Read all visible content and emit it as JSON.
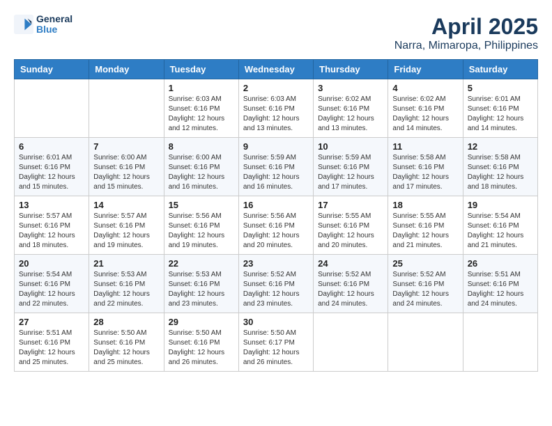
{
  "header": {
    "logo_line1": "General",
    "logo_line2": "Blue",
    "title": "April 2025",
    "subtitle": "Narra, Mimaropa, Philippines"
  },
  "weekdays": [
    "Sunday",
    "Monday",
    "Tuesday",
    "Wednesday",
    "Thursday",
    "Friday",
    "Saturday"
  ],
  "weeks": [
    [
      {
        "day": null,
        "info": null
      },
      {
        "day": null,
        "info": null
      },
      {
        "day": "1",
        "info": "Sunrise: 6:03 AM\nSunset: 6:16 PM\nDaylight: 12 hours\nand 12 minutes."
      },
      {
        "day": "2",
        "info": "Sunrise: 6:03 AM\nSunset: 6:16 PM\nDaylight: 12 hours\nand 13 minutes."
      },
      {
        "day": "3",
        "info": "Sunrise: 6:02 AM\nSunset: 6:16 PM\nDaylight: 12 hours\nand 13 minutes."
      },
      {
        "day": "4",
        "info": "Sunrise: 6:02 AM\nSunset: 6:16 PM\nDaylight: 12 hours\nand 14 minutes."
      },
      {
        "day": "5",
        "info": "Sunrise: 6:01 AM\nSunset: 6:16 PM\nDaylight: 12 hours\nand 14 minutes."
      }
    ],
    [
      {
        "day": "6",
        "info": "Sunrise: 6:01 AM\nSunset: 6:16 PM\nDaylight: 12 hours\nand 15 minutes."
      },
      {
        "day": "7",
        "info": "Sunrise: 6:00 AM\nSunset: 6:16 PM\nDaylight: 12 hours\nand 15 minutes."
      },
      {
        "day": "8",
        "info": "Sunrise: 6:00 AM\nSunset: 6:16 PM\nDaylight: 12 hours\nand 16 minutes."
      },
      {
        "day": "9",
        "info": "Sunrise: 5:59 AM\nSunset: 6:16 PM\nDaylight: 12 hours\nand 16 minutes."
      },
      {
        "day": "10",
        "info": "Sunrise: 5:59 AM\nSunset: 6:16 PM\nDaylight: 12 hours\nand 17 minutes."
      },
      {
        "day": "11",
        "info": "Sunrise: 5:58 AM\nSunset: 6:16 PM\nDaylight: 12 hours\nand 17 minutes."
      },
      {
        "day": "12",
        "info": "Sunrise: 5:58 AM\nSunset: 6:16 PM\nDaylight: 12 hours\nand 18 minutes."
      }
    ],
    [
      {
        "day": "13",
        "info": "Sunrise: 5:57 AM\nSunset: 6:16 PM\nDaylight: 12 hours\nand 18 minutes."
      },
      {
        "day": "14",
        "info": "Sunrise: 5:57 AM\nSunset: 6:16 PM\nDaylight: 12 hours\nand 19 minutes."
      },
      {
        "day": "15",
        "info": "Sunrise: 5:56 AM\nSunset: 6:16 PM\nDaylight: 12 hours\nand 19 minutes."
      },
      {
        "day": "16",
        "info": "Sunrise: 5:56 AM\nSunset: 6:16 PM\nDaylight: 12 hours\nand 20 minutes."
      },
      {
        "day": "17",
        "info": "Sunrise: 5:55 AM\nSunset: 6:16 PM\nDaylight: 12 hours\nand 20 minutes."
      },
      {
        "day": "18",
        "info": "Sunrise: 5:55 AM\nSunset: 6:16 PM\nDaylight: 12 hours\nand 21 minutes."
      },
      {
        "day": "19",
        "info": "Sunrise: 5:54 AM\nSunset: 6:16 PM\nDaylight: 12 hours\nand 21 minutes."
      }
    ],
    [
      {
        "day": "20",
        "info": "Sunrise: 5:54 AM\nSunset: 6:16 PM\nDaylight: 12 hours\nand 22 minutes."
      },
      {
        "day": "21",
        "info": "Sunrise: 5:53 AM\nSunset: 6:16 PM\nDaylight: 12 hours\nand 22 minutes."
      },
      {
        "day": "22",
        "info": "Sunrise: 5:53 AM\nSunset: 6:16 PM\nDaylight: 12 hours\nand 23 minutes."
      },
      {
        "day": "23",
        "info": "Sunrise: 5:52 AM\nSunset: 6:16 PM\nDaylight: 12 hours\nand 23 minutes."
      },
      {
        "day": "24",
        "info": "Sunrise: 5:52 AM\nSunset: 6:16 PM\nDaylight: 12 hours\nand 24 minutes."
      },
      {
        "day": "25",
        "info": "Sunrise: 5:52 AM\nSunset: 6:16 PM\nDaylight: 12 hours\nand 24 minutes."
      },
      {
        "day": "26",
        "info": "Sunrise: 5:51 AM\nSunset: 6:16 PM\nDaylight: 12 hours\nand 24 minutes."
      }
    ],
    [
      {
        "day": "27",
        "info": "Sunrise: 5:51 AM\nSunset: 6:16 PM\nDaylight: 12 hours\nand 25 minutes."
      },
      {
        "day": "28",
        "info": "Sunrise: 5:50 AM\nSunset: 6:16 PM\nDaylight: 12 hours\nand 25 minutes."
      },
      {
        "day": "29",
        "info": "Sunrise: 5:50 AM\nSunset: 6:16 PM\nDaylight: 12 hours\nand 26 minutes."
      },
      {
        "day": "30",
        "info": "Sunrise: 5:50 AM\nSunset: 6:17 PM\nDaylight: 12 hours\nand 26 minutes."
      },
      {
        "day": null,
        "info": null
      },
      {
        "day": null,
        "info": null
      },
      {
        "day": null,
        "info": null
      }
    ]
  ]
}
